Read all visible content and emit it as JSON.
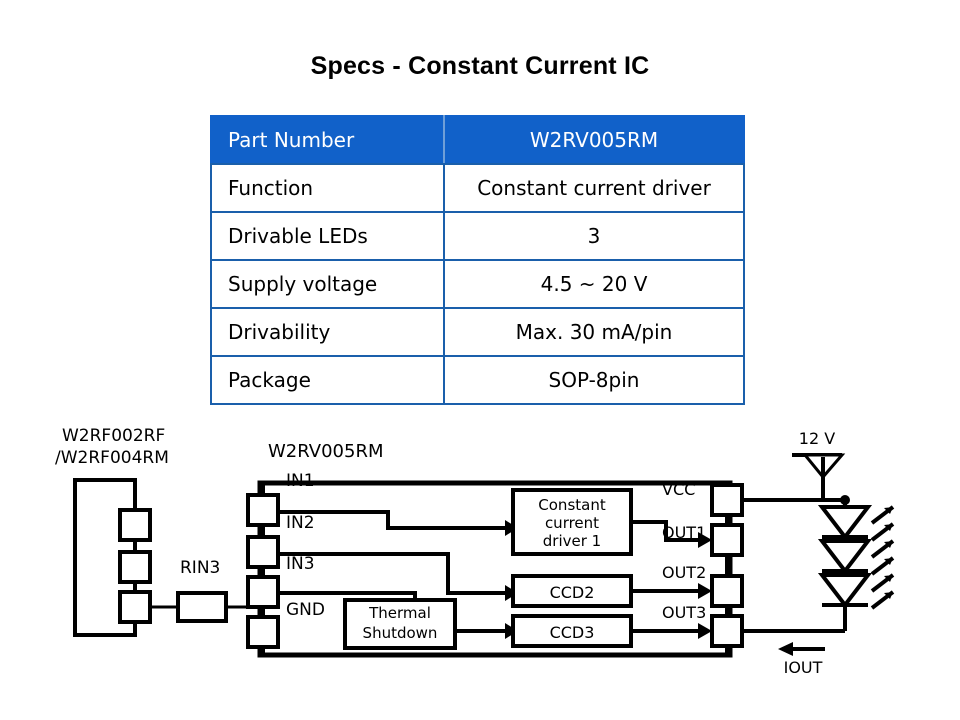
{
  "slide": {
    "title": "Specs - Constant Current IC"
  },
  "spec_table": {
    "rows": [
      {
        "label": "Part Number",
        "value": "W2RV005RM",
        "header": true
      },
      {
        "label": "Function",
        "value": "Constant current driver",
        "header": false
      },
      {
        "label": "Drivable LEDs",
        "value": "3",
        "header": false
      },
      {
        "label": "Supply voltage",
        "value": "4.5 ~ 20 V",
        "header": false
      },
      {
        "label": "Drivability",
        "value": "Max. 30 mA/pin",
        "header": false
      },
      {
        "label": "Package",
        "value": "SOP-8pin",
        "header": false
      }
    ],
    "header_color": "#1161c9",
    "border_color": "#1a5fab"
  },
  "diagram": {
    "left_block_label_line1": "W2RF002RF",
    "left_block_label_line2": "/W2RF004RM",
    "ic_label": "W2RV005RM",
    "resistor_label": "RIN3",
    "input_pins": [
      "IN1",
      "IN2",
      "IN3",
      "GND"
    ],
    "output_pins": [
      "VCC",
      "OUT1",
      "OUT2",
      "OUT3"
    ],
    "blocks": {
      "driver1_line1": "Constant",
      "driver1_line2": "current",
      "driver1_line3": "driver 1",
      "ccd2": "CCD2",
      "ccd3": "CCD3",
      "thermal_line1": "Thermal",
      "thermal_line2": "Shutdown"
    },
    "supply_label": "12 V",
    "current_label": "IOUT",
    "led_count": 3
  }
}
